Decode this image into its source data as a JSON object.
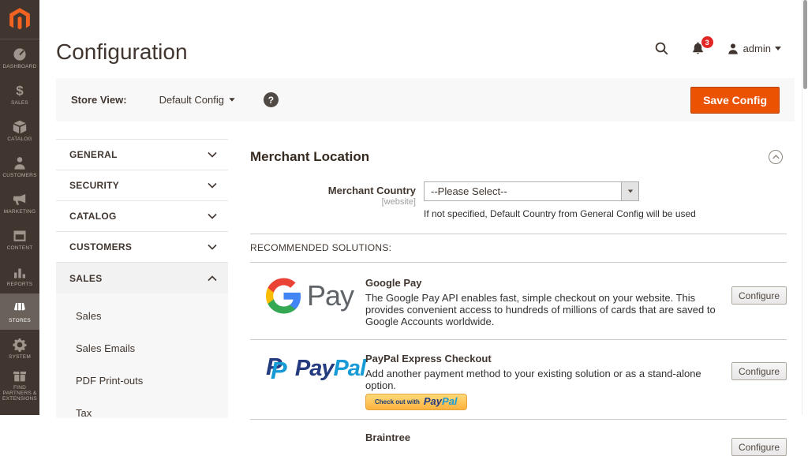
{
  "app": {
    "title": "Configuration"
  },
  "sidebar": {
    "items": [
      {
        "label": "DASHBOARD",
        "icon": "dashboard-icon"
      },
      {
        "label": "SALES",
        "icon": "sales-icon"
      },
      {
        "label": "CATALOG",
        "icon": "catalog-icon"
      },
      {
        "label": "CUSTOMERS",
        "icon": "customers-icon"
      },
      {
        "label": "MARKETING",
        "icon": "marketing-icon"
      },
      {
        "label": "CONTENT",
        "icon": "content-icon"
      },
      {
        "label": "REPORTS",
        "icon": "reports-icon"
      },
      {
        "label": "STORES",
        "icon": "stores-icon",
        "active": true
      },
      {
        "label": "SYSTEM",
        "icon": "system-icon"
      },
      {
        "label": "FIND PARTNERS & EXTENSIONS",
        "icon": "extensions-icon"
      }
    ]
  },
  "header": {
    "notifications": {
      "count": "3"
    },
    "user": {
      "name": "admin"
    }
  },
  "toolbar": {
    "store_view_label": "Store View:",
    "store_view_value": "Default Config",
    "help_glyph": "?",
    "save_label": "Save Config"
  },
  "config_nav": {
    "sections": [
      {
        "label": "GENERAL",
        "state": "collapsed"
      },
      {
        "label": "SECURITY",
        "state": "collapsed"
      },
      {
        "label": "CATALOG",
        "state": "collapsed"
      },
      {
        "label": "CUSTOMERS",
        "state": "collapsed"
      },
      {
        "label": "SALES",
        "state": "expanded"
      }
    ],
    "sales_subitems": [
      {
        "label": "Sales"
      },
      {
        "label": "Sales Emails"
      },
      {
        "label": "PDF Print-outs"
      },
      {
        "label": "Tax"
      }
    ]
  },
  "main": {
    "section_title": "Merchant Location",
    "merchant_country": {
      "label": "Merchant Country",
      "scope": "[website]",
      "value": "--Please Select--",
      "note": "If not specified, Default Country from General Config will be used"
    },
    "recommended_label": "RECOMMENDED SOLUTIONS:",
    "solutions": [
      {
        "name": "Google Pay",
        "logo_text": "Pay",
        "description": "The Google Pay API enables fast, simple checkout on your website. This provides convenient access to hundreds of millions of cards that are saved to Google Accounts worldwide.",
        "action": "Configure"
      },
      {
        "name": "PayPal Express Checkout",
        "logo_word_pay": "Pay",
        "logo_word_pal": "Pal",
        "description": "Add another payment method to your existing solution or as a stand-alone option.",
        "checkout_prefix": "Check out with",
        "checkout_brand_pay": "Pay",
        "checkout_brand_pal": "Pal",
        "action": "Configure"
      },
      {
        "name": "Braintree",
        "action": "Configure"
      }
    ]
  },
  "colors": {
    "accent_orange": "#eb5202",
    "notification_red": "#e22626",
    "sidebar_dark": "#41362f",
    "magento_orange": "#f26322",
    "paypal_navy": "#253b80",
    "paypal_blue": "#179bd7",
    "paypal_gold": "#ffc439",
    "google_blue": "#4285f4",
    "google_red": "#ea4335",
    "google_yellow": "#fbbc05",
    "google_green": "#34a853",
    "gpay_gray": "#5f6368"
  }
}
